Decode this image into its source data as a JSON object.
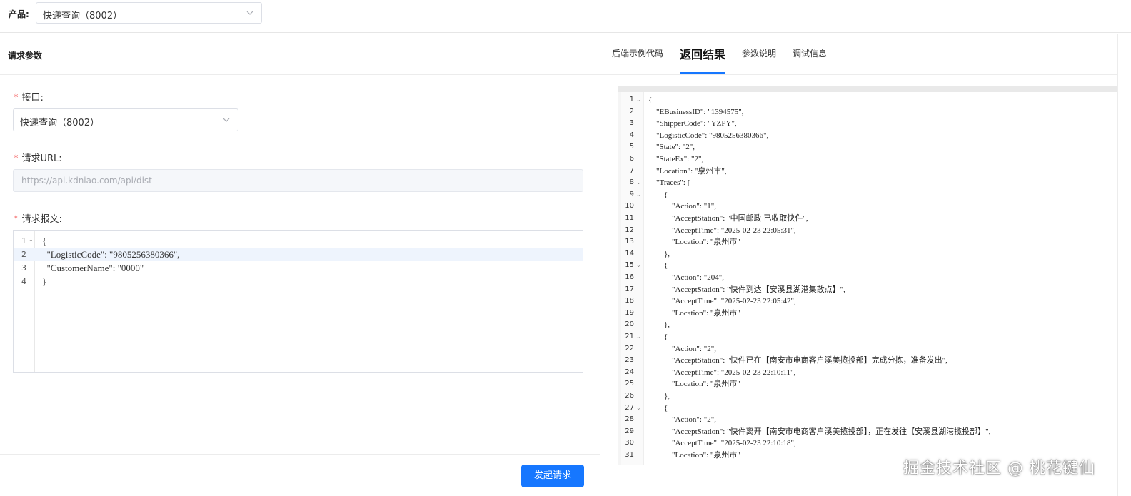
{
  "product": {
    "label": "产品:",
    "selected": "快递查询（8002）"
  },
  "request": {
    "panel_title": "请求参数",
    "interface_label": "接口:",
    "interface_selected": "快递查询（8002）",
    "url_label": "请求URL:",
    "url_placeholder": "https://api.kdniao.com/api/dist",
    "body_label": "请求报文:",
    "body_lines": [
      {
        "n": "1",
        "fold": true,
        "text": "{"
      },
      {
        "n": "2",
        "fold": false,
        "text": "  \"LogisticCode\": \"9805256380366\","
      },
      {
        "n": "3",
        "fold": false,
        "text": "  \"CustomerName\": \"0000\""
      },
      {
        "n": "4",
        "fold": false,
        "text": "}"
      }
    ],
    "submit_label": "发起请求"
  },
  "tabs": {
    "items": [
      "后端示例代码",
      "返回结果",
      "参数说明",
      "调试信息"
    ],
    "active": "返回结果"
  },
  "result_lines": [
    {
      "n": "1",
      "fold": true,
      "text": "{"
    },
    {
      "n": "2",
      "fold": false,
      "text": "    \"EBusinessID\": \"1394575\","
    },
    {
      "n": "3",
      "fold": false,
      "text": "    \"ShipperCode\": \"YZPY\","
    },
    {
      "n": "4",
      "fold": false,
      "text": "    \"LogisticCode\": \"9805256380366\","
    },
    {
      "n": "5",
      "fold": false,
      "text": "    \"State\": \"2\","
    },
    {
      "n": "6",
      "fold": false,
      "text": "    \"StateEx\": \"2\","
    },
    {
      "n": "7",
      "fold": false,
      "text": "    \"Location\": \"泉州市\","
    },
    {
      "n": "8",
      "fold": true,
      "text": "    \"Traces\": ["
    },
    {
      "n": "9",
      "fold": true,
      "text": "        {"
    },
    {
      "n": "10",
      "fold": false,
      "text": "            \"Action\": \"1\","
    },
    {
      "n": "11",
      "fold": false,
      "text": "            \"AcceptStation\": \"中国邮政 已收取快件\","
    },
    {
      "n": "12",
      "fold": false,
      "text": "            \"AcceptTime\": \"2025-02-23 22:05:31\","
    },
    {
      "n": "13",
      "fold": false,
      "text": "            \"Location\": \"泉州市\""
    },
    {
      "n": "14",
      "fold": false,
      "text": "        },"
    },
    {
      "n": "15",
      "fold": true,
      "text": "        {"
    },
    {
      "n": "16",
      "fold": false,
      "text": "            \"Action\": \"204\","
    },
    {
      "n": "17",
      "fold": false,
      "text": "            \"AcceptStation\": \"快件到达【安溪县湖港集散点】\","
    },
    {
      "n": "18",
      "fold": false,
      "text": "            \"AcceptTime\": \"2025-02-23 22:05:42\","
    },
    {
      "n": "19",
      "fold": false,
      "text": "            \"Location\": \"泉州市\""
    },
    {
      "n": "20",
      "fold": false,
      "text": "        },"
    },
    {
      "n": "21",
      "fold": true,
      "text": "        {"
    },
    {
      "n": "22",
      "fold": false,
      "text": "            \"Action\": \"2\","
    },
    {
      "n": "23",
      "fold": false,
      "text": "            \"AcceptStation\": \"快件已在【南安市电商客户溪美揽投部】完成分拣，准备发出\","
    },
    {
      "n": "24",
      "fold": false,
      "text": "            \"AcceptTime\": \"2025-02-23 22:10:11\","
    },
    {
      "n": "25",
      "fold": false,
      "text": "            \"Location\": \"泉州市\""
    },
    {
      "n": "26",
      "fold": false,
      "text": "        },"
    },
    {
      "n": "27",
      "fold": true,
      "text": "        {"
    },
    {
      "n": "28",
      "fold": false,
      "text": "            \"Action\": \"2\","
    },
    {
      "n": "29",
      "fold": false,
      "text": "            \"AcceptStation\": \"快件离开【南安市电商客户溪美揽投部】，正在发往【安溪县湖港揽投部】\","
    },
    {
      "n": "30",
      "fold": false,
      "text": "            \"AcceptTime\": \"2025-02-23 22:10:18\","
    },
    {
      "n": "31",
      "fold": false,
      "text": "            \"Location\": \"泉州市\""
    }
  ],
  "watermark": "掘金技术社区 @ 桃花键仙",
  "colors": {
    "primary": "#1677ff",
    "required_star": "#f56c6c"
  }
}
